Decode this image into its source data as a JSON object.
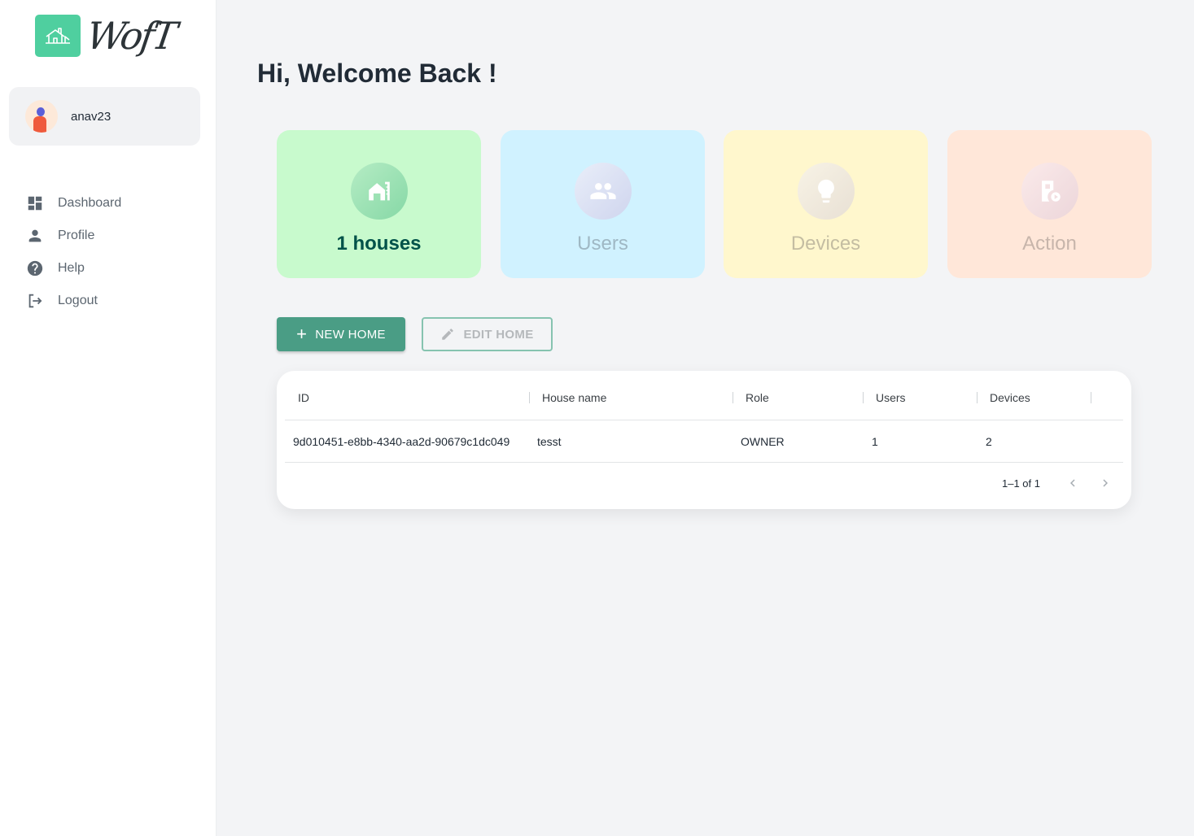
{
  "brand": {
    "logo_text": "WofT",
    "accent": "#4fcf9f"
  },
  "account": {
    "username": "anav23"
  },
  "nav": [
    {
      "label": "Dashboard",
      "icon": "dashboard-icon"
    },
    {
      "label": "Profile",
      "icon": "person-icon"
    },
    {
      "label": "Help",
      "icon": "help-icon"
    },
    {
      "label": "Logout",
      "icon": "logout-icon"
    }
  ],
  "page": {
    "title": "Hi, Welcome Back !"
  },
  "cards": [
    {
      "label": "1 houses",
      "icon": "house-icon"
    },
    {
      "label": "Users",
      "icon": "users-icon"
    },
    {
      "label": "Devices",
      "icon": "lightbulb-icon"
    },
    {
      "label": "Action",
      "icon": "action-icon"
    }
  ],
  "buttons": {
    "new_home": "NEW HOME",
    "edit_home": "EDIT HOME"
  },
  "table": {
    "columns": [
      "ID",
      "House name",
      "Role",
      "Users",
      "Devices"
    ],
    "rows": [
      {
        "id": "9d010451-e8bb-4340-aa2d-90679c1dc049",
        "house_name": "tesst",
        "role": "OWNER",
        "users": "1",
        "devices": "2"
      }
    ],
    "pagination": "1–1 of 1"
  }
}
